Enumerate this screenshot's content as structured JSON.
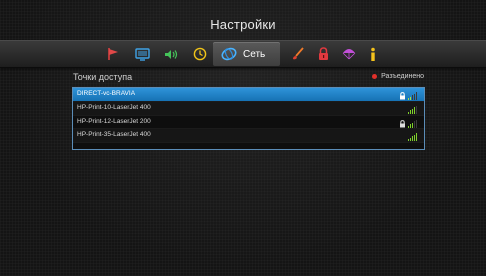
{
  "title": "Настройки",
  "tabs": {
    "active_label": "Сеть"
  },
  "section": {
    "label": "Точки доступа",
    "status": "Разъединено",
    "status_color": "#e0302a"
  },
  "access_points": [
    {
      "name": "DIRECT-vc-BRAVIA",
      "locked": true,
      "signal": 2,
      "selected": true
    },
    {
      "name": "HP-Print-10-LaserJet 400",
      "locked": false,
      "signal": 4,
      "selected": false
    },
    {
      "name": "HP-Print-12-LaserJet 200",
      "locked": true,
      "signal": 3,
      "selected": false
    },
    {
      "name": "HP-Print-35-LaserJet 400",
      "locked": false,
      "signal": 5,
      "selected": false
    }
  ],
  "colors": {
    "accent": "#1e86cc",
    "signal": "#7fd12a"
  }
}
